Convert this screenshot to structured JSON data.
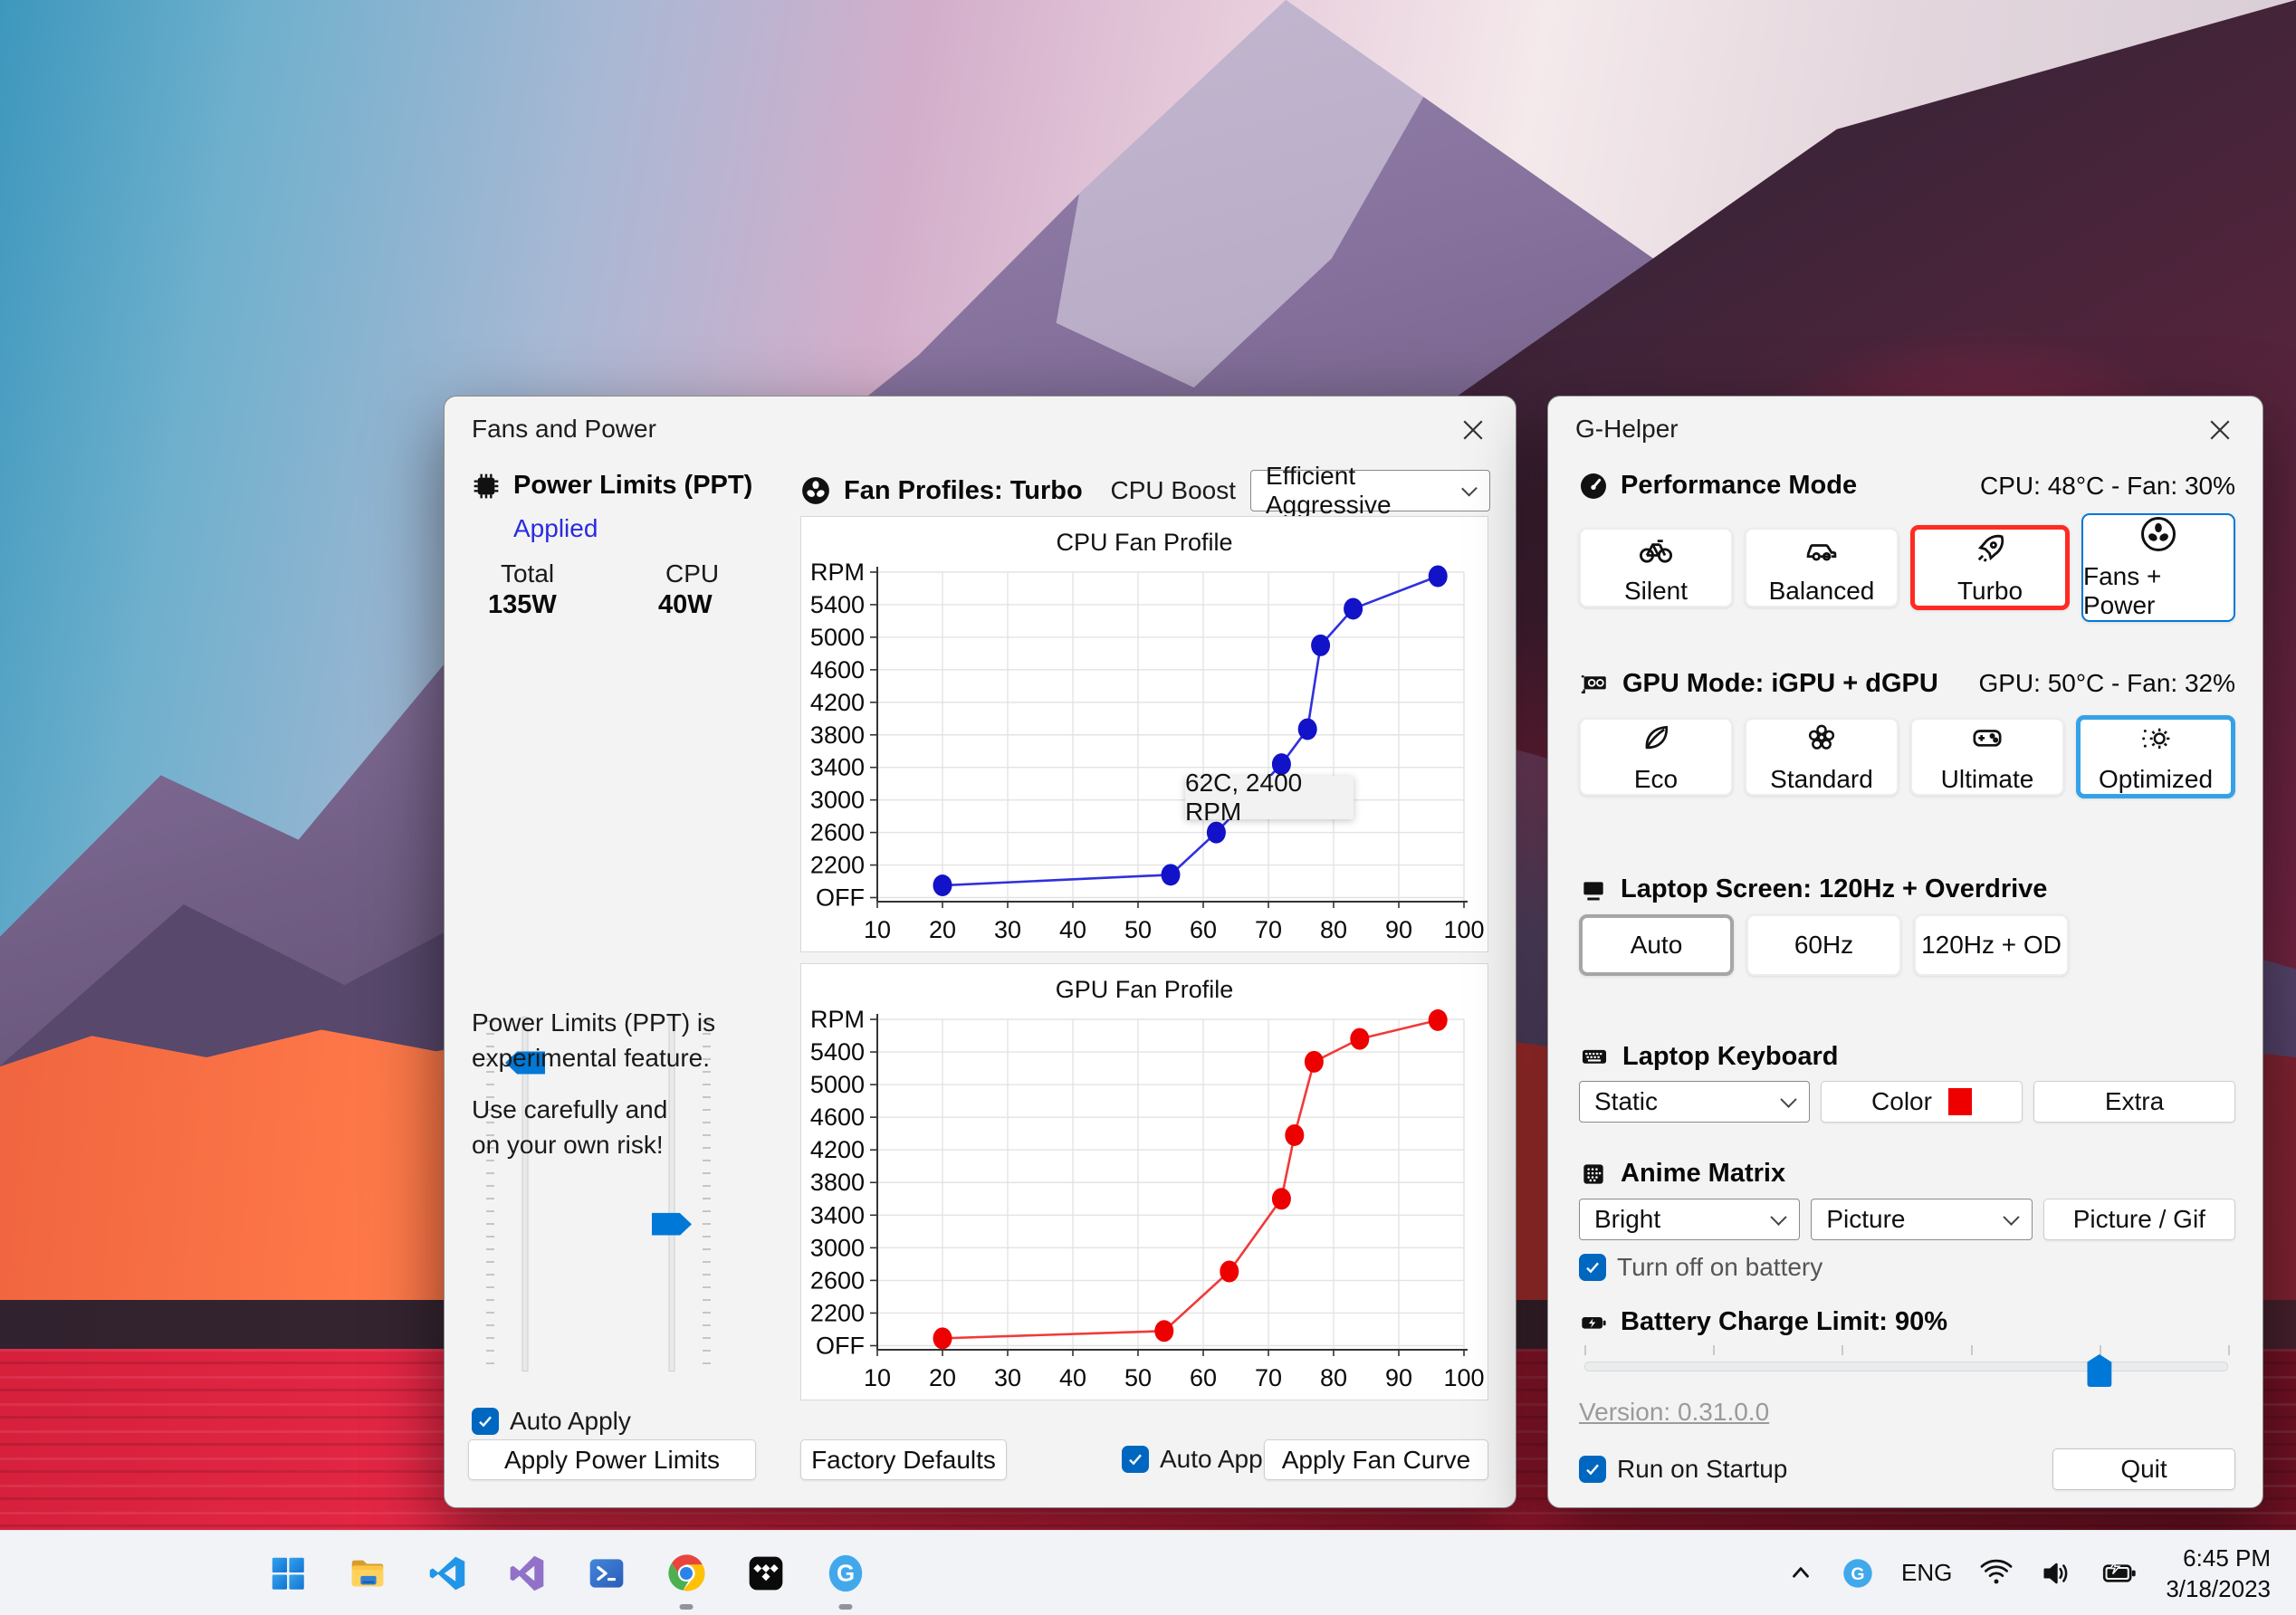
{
  "accent": {
    "blue": "#0078d7",
    "checkbox_blue": "#0067c0",
    "selected_red": "#ff2b23",
    "selected_blue": "#35a2e8",
    "link_blue": "#2a2ae0",
    "keyboard_swatch": "#ee0000"
  },
  "fans_window": {
    "title": "Fans and Power",
    "power_limits": {
      "header": "Power Limits (PPT)",
      "applied_link": "Applied",
      "total_label": "Total",
      "total_value": "135W",
      "cpu_label": "CPU",
      "cpu_value": "40W",
      "warning_line1": "Power Limits (PPT) is",
      "warning_line2": "experimental feature.",
      "warning_line3": "Use carefully and",
      "warning_line4": "on your own risk!",
      "auto_apply_label": "Auto Apply",
      "apply_button": "Apply Power Limits"
    },
    "fan_profiles": {
      "header": "Fan Profiles: Turbo",
      "cpu_boost_label": "CPU Boost",
      "cpu_boost_value": "Efficient Aggressive",
      "factory_defaults_button": "Factory Defaults",
      "auto_apply_label": "Auto Apply",
      "apply_button": "Apply Fan Curve"
    }
  },
  "chart_data": [
    {
      "type": "line",
      "title": "CPU Fan Profile",
      "series": [
        {
          "name": "CPU fan curve",
          "x": [
            20,
            55,
            62,
            72,
            76,
            78,
            83,
            96
          ],
          "y": [
            1950,
            2080,
            2600,
            3440,
            3870,
            4900,
            5350,
            5750
          ]
        }
      ],
      "line_color": "#3030dc",
      "marker_color": "#1212c8",
      "xticks": [
        10,
        20,
        30,
        40,
        50,
        60,
        70,
        80,
        90,
        100
      ],
      "ytick_values": [
        1800,
        2200,
        2600,
        3000,
        3400,
        3800,
        4200,
        4600,
        5000,
        5400,
        5800
      ],
      "ytick_labels": [
        "OFF",
        "2200",
        "2600",
        "3000",
        "3400",
        "3800",
        "4200",
        "4600",
        "5000",
        "5400",
        "RPM"
      ],
      "xlim": [
        10,
        100
      ],
      "ylim": [
        1750,
        5800
      ],
      "grid": true,
      "legend": "none",
      "annotation": "62C, 2400 RPM"
    },
    {
      "type": "line",
      "title": "GPU Fan Profile",
      "series": [
        {
          "name": "GPU fan curve",
          "x": [
            20,
            54,
            64,
            72,
            74,
            77,
            84,
            96
          ],
          "y": [
            1890,
            1980,
            2710,
            3600,
            4380,
            5280,
            5560,
            5790
          ]
        }
      ],
      "line_color": "#f03a3a",
      "marker_color": "#ee0000",
      "xticks": [
        10,
        20,
        30,
        40,
        50,
        60,
        70,
        80,
        90,
        100
      ],
      "ytick_values": [
        1800,
        2200,
        2600,
        3000,
        3400,
        3800,
        4200,
        4600,
        5000,
        5400,
        5800
      ],
      "ytick_labels": [
        "OFF",
        "2200",
        "2600",
        "3000",
        "3400",
        "3800",
        "4200",
        "4600",
        "5000",
        "5400",
        "RPM"
      ],
      "xlim": [
        10,
        100
      ],
      "ylim": [
        1750,
        5800
      ],
      "grid": true,
      "legend": "none",
      "annotation": ""
    }
  ],
  "ghelper_window": {
    "title": "G-Helper",
    "performance": {
      "header": "Performance Mode",
      "status": "CPU: 48°C -  Fan: 30%",
      "modes": [
        {
          "label": "Silent"
        },
        {
          "label": "Balanced"
        },
        {
          "label": "Turbo"
        },
        {
          "label": "Fans + Power"
        }
      ],
      "selected": "Turbo"
    },
    "gpu": {
      "header": "GPU Mode: iGPU + dGPU",
      "status": "GPU: 50°C -  Fan: 32%",
      "modes": [
        {
          "label": "Eco"
        },
        {
          "label": "Standard"
        },
        {
          "label": "Ultimate"
        },
        {
          "label": "Optimized"
        }
      ],
      "selected": "Optimized"
    },
    "screen": {
      "header": "Laptop Screen: 120Hz + Overdrive",
      "options": [
        {
          "label": "Auto"
        },
        {
          "label": "60Hz"
        },
        {
          "label": "120Hz + OD"
        }
      ],
      "selected": "Auto"
    },
    "keyboard": {
      "header": "Laptop Keyboard",
      "mode_value": "Static",
      "color_button": "Color",
      "extra_button": "Extra"
    },
    "anime": {
      "header": "Anime Matrix",
      "brightness_value": "Bright",
      "content_value": "Picture",
      "picture_button": "Picture / Gif",
      "battery_checkbox_label": "Turn off on battery"
    },
    "battery": {
      "header": "Battery Charge Limit: 90%"
    },
    "version_link": "Version: 0.31.0.0",
    "startup_checkbox_label": "Run on Startup",
    "quit_button": "Quit"
  },
  "taskbar": {
    "icons": [
      "start",
      "file-explorer",
      "vscode",
      "visual-studio",
      "terminal",
      "chrome",
      "tidal",
      "g-helper"
    ],
    "running": [
      "chrome",
      "g-helper"
    ],
    "tray": {
      "language": "ENG",
      "time": "6:45 PM",
      "date": "3/18/2023"
    }
  }
}
